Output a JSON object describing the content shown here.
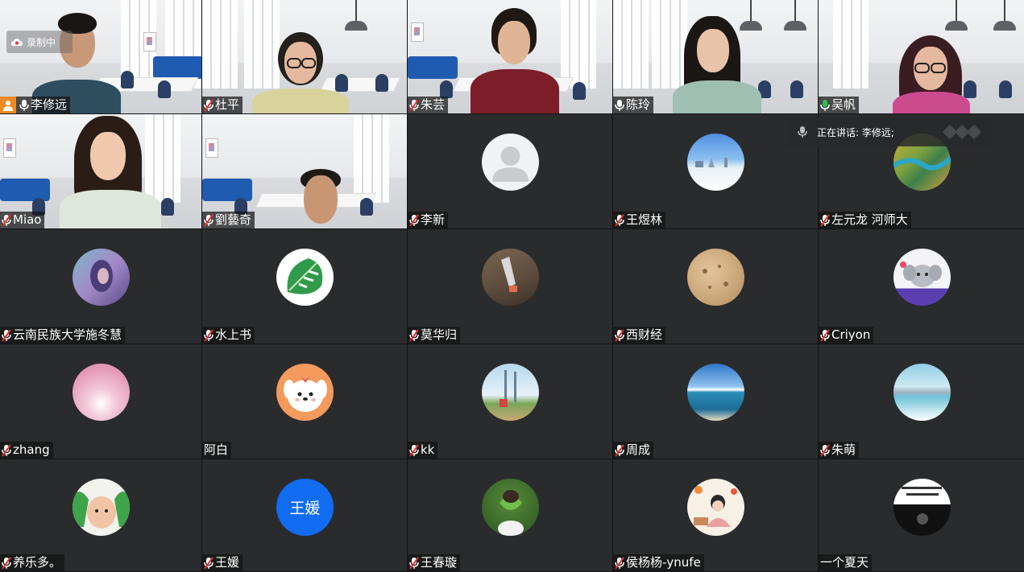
{
  "recording": {
    "label": "录制中"
  },
  "speaking": {
    "label": "正在讲话: 李修远;"
  },
  "participants": [
    {
      "name": "李修远",
      "video": true,
      "host": true,
      "muted": false
    },
    {
      "name": "杜平",
      "video": true,
      "muted": true
    },
    {
      "name": "朱芸",
      "video": true,
      "muted": true
    },
    {
      "name": "陈玲",
      "video": true,
      "muted": false
    },
    {
      "name": "吴帆",
      "video": true,
      "muted": false
    },
    {
      "name": "Miao",
      "video": true,
      "muted": true
    },
    {
      "name": "劉藝奇",
      "video": true,
      "muted": true
    },
    {
      "name": "李新",
      "muted": true,
      "avatar": "default-avatar-icon"
    },
    {
      "name": "王煜林",
      "muted": true,
      "avatar": "snow-landscape"
    },
    {
      "name": "左元龙 河师大",
      "muted": true,
      "avatar": "aerial-fields"
    },
    {
      "name": "云南民族大学施冬慧",
      "muted": true,
      "avatar": "painting-woman"
    },
    {
      "name": "水上书",
      "muted": true,
      "avatar": "monstera-leaf"
    },
    {
      "name": "莫华归",
      "muted": true,
      "avatar": "hand-photo"
    },
    {
      "name": "西财经",
      "muted": true,
      "avatar": "sand-texture"
    },
    {
      "name": "Criyon",
      "muted": true,
      "avatar": "cartoon-elephant"
    },
    {
      "name": "zhang",
      "muted": true,
      "avatar": "pink-feathers"
    },
    {
      "name": "阿白",
      "muted": false,
      "no_mic": true,
      "avatar": "cartoon-dog"
    },
    {
      "name": "kk",
      "muted": true,
      "avatar": "beach-towers"
    },
    {
      "name": "周成",
      "muted": true,
      "avatar": "ocean-sky"
    },
    {
      "name": "朱萌",
      "muted": true,
      "avatar": "lake-mountains"
    },
    {
      "name": "养乐多。",
      "muted": true,
      "avatar": "baby-photo"
    },
    {
      "name": "王媛",
      "muted": true,
      "avatar_text": "王媛"
    },
    {
      "name": "王春璇",
      "muted": true,
      "avatar": "girl-leaf"
    },
    {
      "name": "侯杨杨-ynufe",
      "muted": true,
      "avatar": "illustration-girl"
    },
    {
      "name": "一个夏天",
      "muted": false,
      "no_mic": true,
      "avatar": "dark-text-photo"
    }
  ]
}
